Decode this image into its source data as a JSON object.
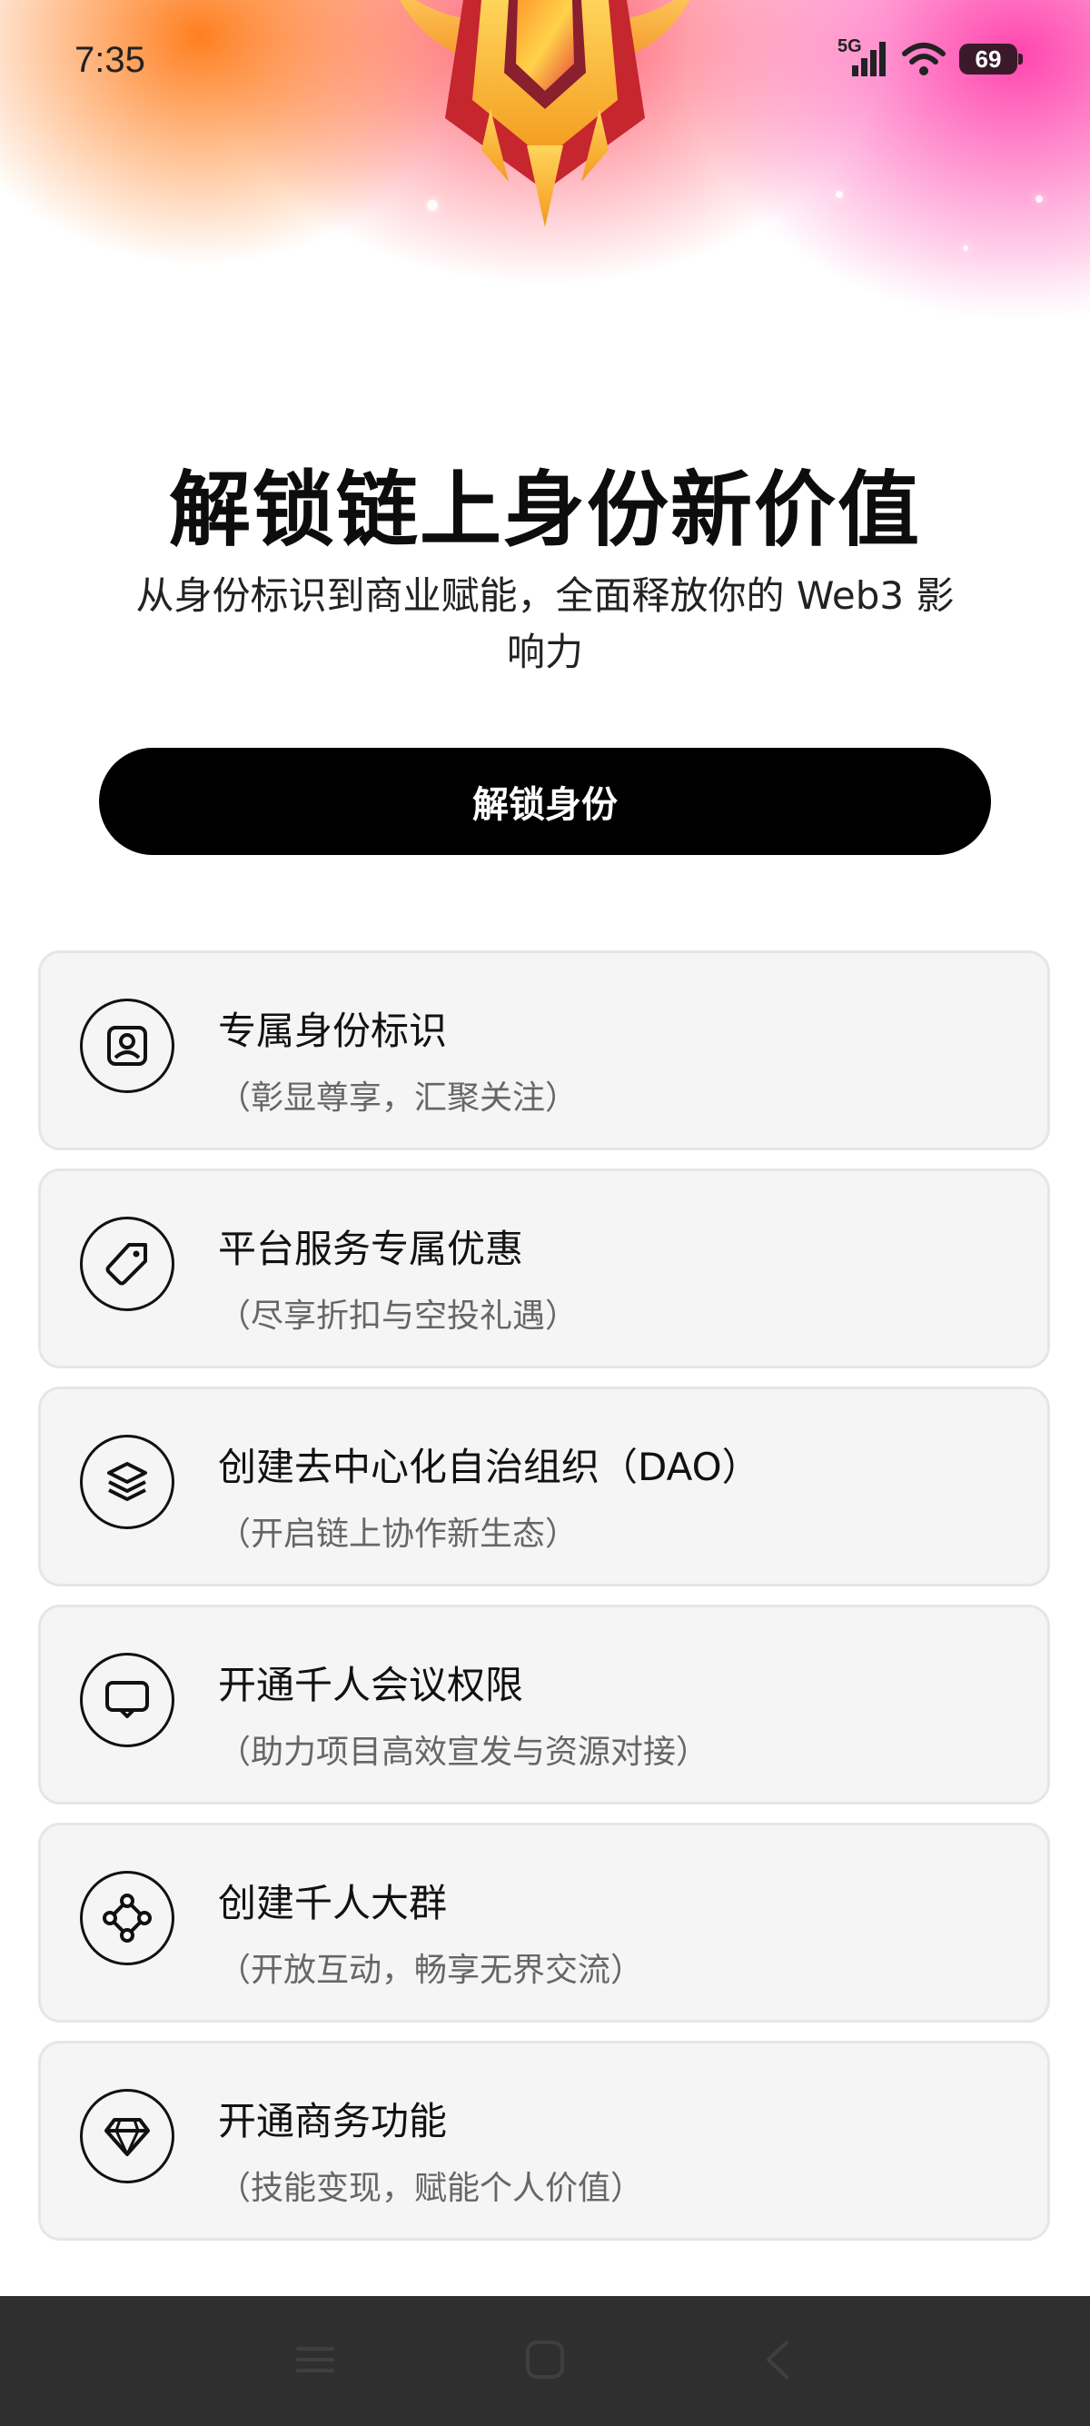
{
  "status_bar": {
    "time": "7:35",
    "network": "5G",
    "battery": "69"
  },
  "hero": {
    "title": "解锁链上身份新价值",
    "subtitle": "从身份标识到商业赋能，全面释放你的 Web3 影响力"
  },
  "cta": {
    "label": "解锁身份"
  },
  "features": [
    {
      "icon": "id-badge-icon",
      "title": "专属身份标识",
      "subtitle": "（彰显尊享，汇聚关注）"
    },
    {
      "icon": "tag-icon",
      "title": "平台服务专属优惠",
      "subtitle": "（尽享折扣与空投礼遇）"
    },
    {
      "icon": "layers-icon",
      "title": "创建去中心化自治组织（DAO）",
      "subtitle": "（开启链上协作新生态）"
    },
    {
      "icon": "presentation-icon",
      "title": "开通千人会议权限",
      "subtitle": "（助力项目高效宣发与资源对接）"
    },
    {
      "icon": "network-icon",
      "title": "创建千人大群",
      "subtitle": "（开放互动，畅享无界交流）"
    },
    {
      "icon": "diamond-icon",
      "title": "开通商务功能",
      "subtitle": "（技能变现，赋能个人价值）"
    }
  ],
  "nav_bar": {
    "buttons": [
      "menu-icon",
      "home-icon",
      "back-icon"
    ]
  }
}
